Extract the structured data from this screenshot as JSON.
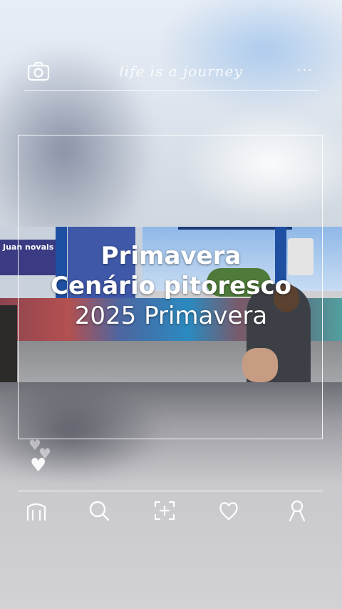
{
  "header": {
    "script_text": "life is a journey",
    "menu_glyph": "···",
    "icons": [
      "camera-icon",
      "more-icon"
    ]
  },
  "caption": {
    "line1": "Primavera",
    "line2": "Cenário pitoresco",
    "line3": "2025 Primavera"
  },
  "photo": {
    "sign_text": "Juan\nnovais"
  },
  "hearts": {
    "glyph": "♥"
  },
  "bottom_nav": {
    "items": [
      {
        "icon": "home-icon"
      },
      {
        "icon": "search-icon"
      },
      {
        "icon": "add-icon"
      },
      {
        "icon": "heart-icon"
      },
      {
        "icon": "profile-icon"
      }
    ]
  },
  "colors": {
    "overlay_line": "#ffffff",
    "caption_text": "#ffffff"
  }
}
